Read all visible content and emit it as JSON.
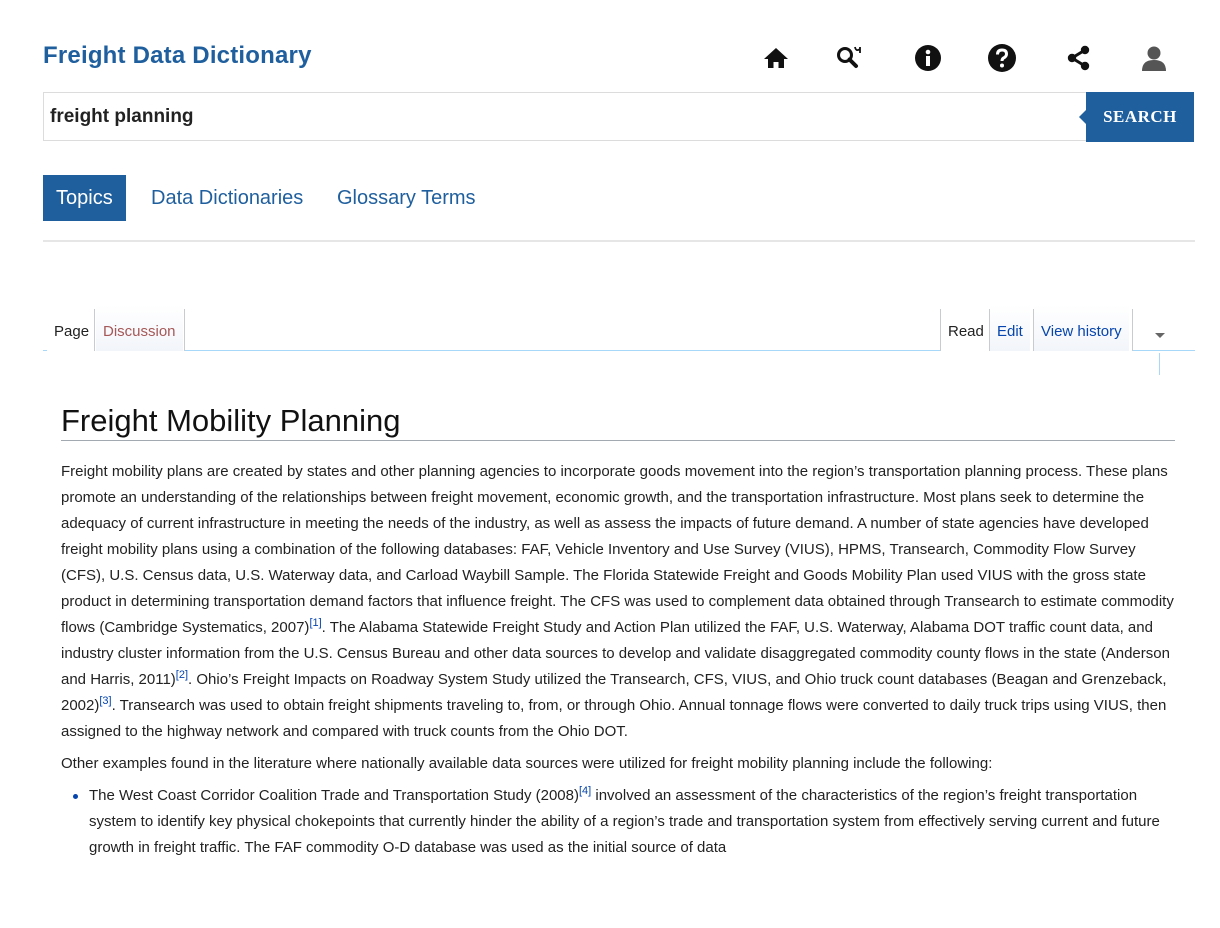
{
  "app": {
    "title": "Freight Data Dictionary"
  },
  "toolbar_icons": [
    "home-icon",
    "search-glossary-icon",
    "info-icon",
    "help-icon",
    "share-icon",
    "user-icon"
  ],
  "search": {
    "value": "freight planning",
    "button_label": "SEARCH"
  },
  "tabs": [
    {
      "label": "Topics",
      "active": true
    },
    {
      "label": "Data Dictionaries",
      "active": false
    },
    {
      "label": "Glossary Terms",
      "active": false
    }
  ],
  "wiki_tabs": {
    "left": [
      {
        "label": "Page"
      },
      {
        "label": "Discussion"
      }
    ],
    "right": [
      {
        "label": "Read"
      },
      {
        "label": "Edit"
      },
      {
        "label": "View history"
      }
    ]
  },
  "article": {
    "title": "Freight Mobility Planning",
    "p1_a": "Freight mobility plans are created by states and other planning agencies to incorporate goods movement into the region’s transportation planning process. These plans promote an understanding of the relationships between freight movement, economic growth, and the transportation infrastructure. Most plans seek to determine the adequacy of current infrastructure in meeting the needs of the industry, as well as assess the impacts of future demand. A number of state agencies have developed freight mobility plans using a combination of the following databases: FAF, Vehicle Inventory and Use Survey (VIUS), HPMS, Transearch, Commodity Flow Survey (CFS), U.S. Census data, U.S. Waterway data, and Carload Waybill Sample. The Florida Statewide Freight and Goods Mobility Plan used VIUS with the gross state product in determining transportation demand factors that influence freight. The CFS was used to complement data obtained through Transearch to estimate commodity flows (Cambridge Systematics, 2007)",
    "ref1": "[1]",
    "p1_b": ". The Alabama Statewide Freight Study and Action Plan utilized the FAF, U.S. Waterway, Alabama DOT traffic count data, and industry cluster information from the U.S. Census Bureau and other data sources to develop and validate disaggregated commodity county flows in the state (Anderson and Harris, 2011)",
    "ref2": "[2]",
    "p1_c": ". Ohio’s Freight Impacts on Roadway System Study utilized the Transearch, CFS, VIUS, and Ohio truck count databases (Beagan and Grenzeback, 2002)",
    "ref3": "[3]",
    "p1_d": ". Transearch was used to obtain freight shipments traveling to, from, or through Ohio. Annual tonnage flows were converted to daily truck trips using VIUS, then assigned to the highway network and compared with truck counts from the Ohio DOT.",
    "p2": "Other examples found in the literature where nationally available data sources were utilized for freight mobility planning include the following:",
    "li1_a": "The West Coast Corridor Coalition Trade and Transportation Study (2008)",
    "ref4": "[4]",
    "li1_b": " involved an assessment of the characteristics of the region’s freight transportation system to identify key physical chokepoints that currently hinder the ability of a region’s trade and transportation system from effectively serving current and future growth in freight traffic. The FAF commodity O-D database was used as the initial source of data"
  },
  "colors": {
    "brand": "#1f5f9e",
    "link": "#0645ad",
    "new_link": "#a55858"
  }
}
